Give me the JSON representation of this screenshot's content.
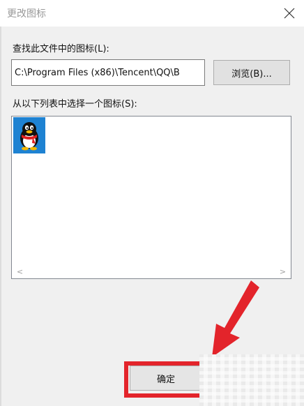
{
  "dialog": {
    "title": "更改图标",
    "path_label": "查找此文件中的图标(L):",
    "path_value": "C:\\Program Files (x86)\\Tencent\\QQ\\B",
    "browse_label": "浏览(B)...",
    "list_label": "从以下列表中选择一个图标(S):",
    "ok_label": "确定"
  },
  "icons": [
    {
      "name": "qq-penguin-icon"
    }
  ],
  "colors": {
    "selection": "#1e82d2",
    "annotation": "#e3242b"
  }
}
